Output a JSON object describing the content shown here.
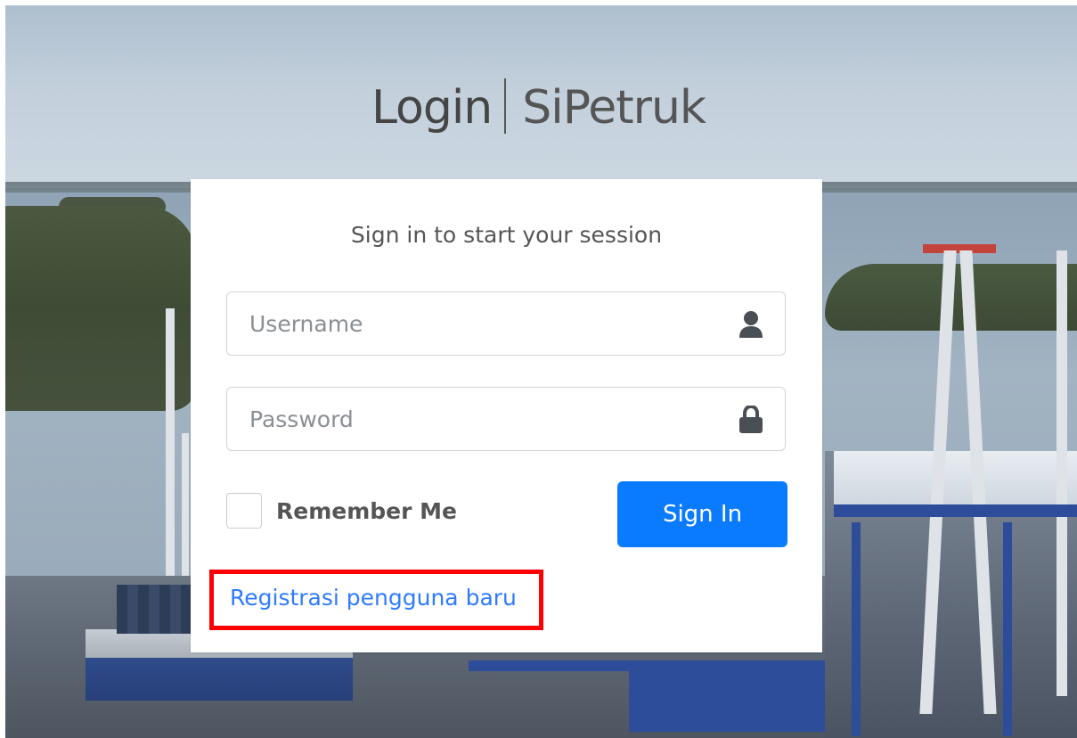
{
  "header": {
    "title_strong": "Login",
    "title_light": "SiPetruk"
  },
  "login": {
    "message": "Sign in to start your session",
    "username": {
      "value": "",
      "placeholder": "Username",
      "icon": "user-icon"
    },
    "password": {
      "value": "",
      "placeholder": "Password",
      "icon": "lock-icon"
    },
    "remember": {
      "label": "Remember Me",
      "checked": false
    },
    "signin_label": "Sign In",
    "register_link": "Registrasi pengguna baru"
  },
  "colors": {
    "primary": "#0a7bff",
    "link": "#2f7bff",
    "highlight": "#ff0000"
  }
}
